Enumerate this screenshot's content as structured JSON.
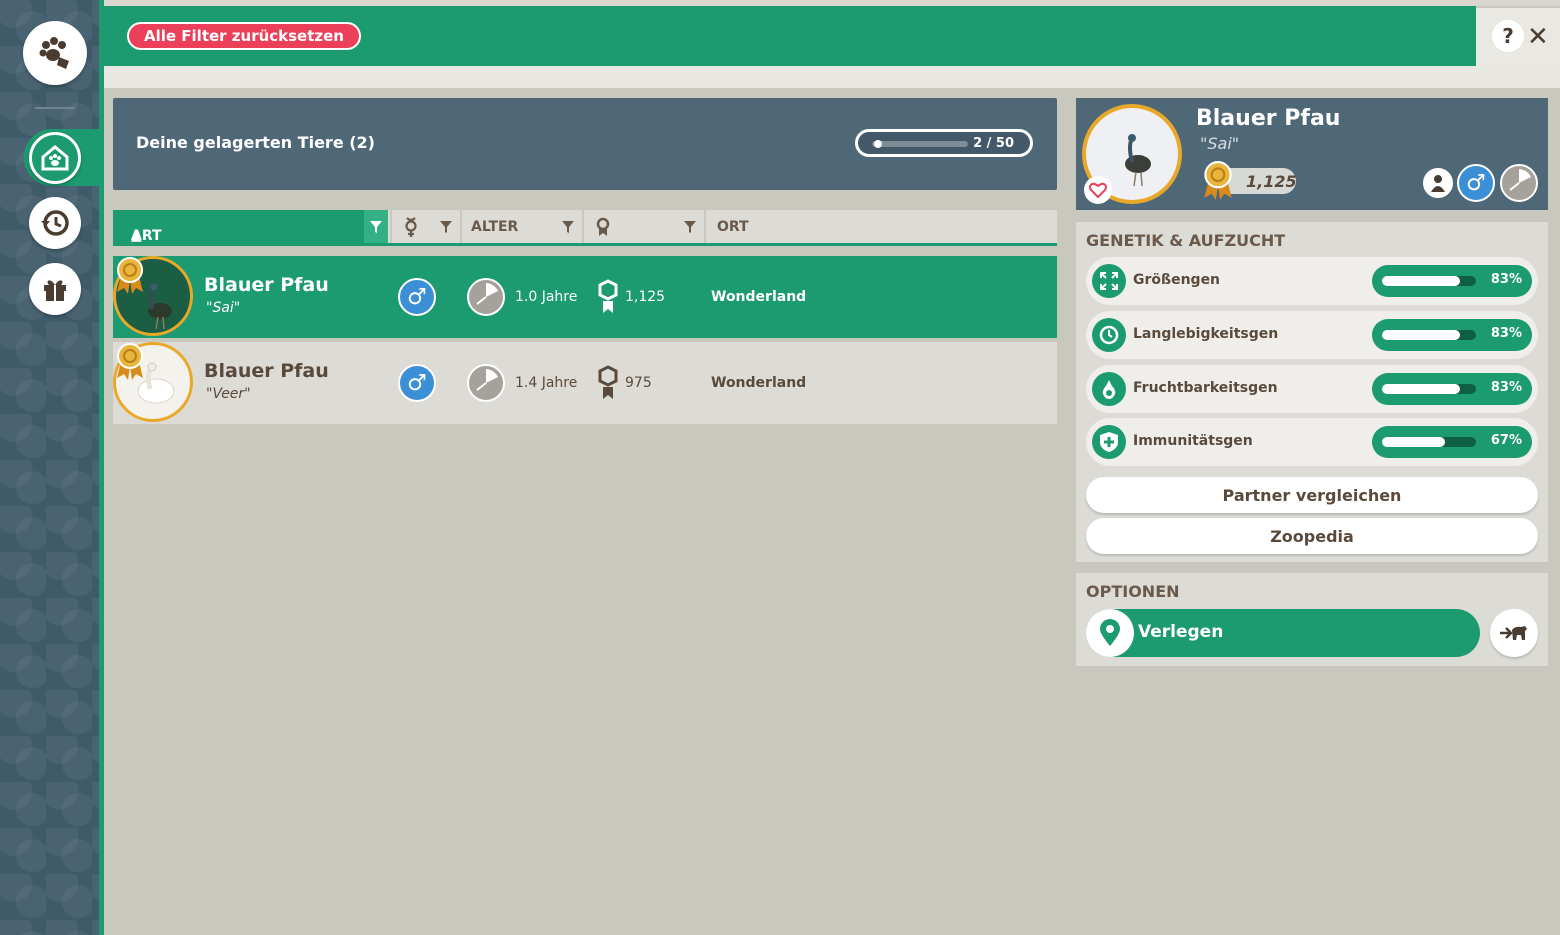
{
  "toolbar": {
    "reset_label": "Alle Filter zurücksetzen",
    "help_label": "?",
    "close_label": "✕"
  },
  "sidebar": {
    "items": [
      {
        "name": "paw-tag-icon"
      },
      {
        "name": "storage-house-icon",
        "active": true
      },
      {
        "name": "history-icon"
      },
      {
        "name": "gift-icon"
      }
    ]
  },
  "storage": {
    "title": "Deine gelagerten Tiere (2)",
    "capacity_label": "2 / 50",
    "capacity_used": 2,
    "capacity_max": 50
  },
  "columns": {
    "art": "ART",
    "alter": "ALTER",
    "ort": "ORT"
  },
  "animals": [
    {
      "name": "Blauer Pfau",
      "nickname": "\"Sai\"",
      "sex": "♂",
      "age": "1.0 Jahre",
      "appeal": "1,125",
      "location": "Wonderland",
      "selected": true
    },
    {
      "name": "Blauer Pfau",
      "nickname": "\"Veer\"",
      "sex": "♂",
      "age": "1.4 Jahre",
      "appeal": "975",
      "location": "Wonderland",
      "selected": false
    }
  ],
  "detail": {
    "name": "Blauer Pfau",
    "nickname": "\"Sai\"",
    "appeal": "1,125",
    "sex": "♂"
  },
  "genetics": {
    "title": "GENETIK & AUFZUCHT",
    "genes": [
      {
        "label": "Größengen",
        "value": "83%",
        "fraction": 0.83,
        "icon": "resize-icon"
      },
      {
        "label": "Langlebigkeitsgen",
        "value": "83%",
        "fraction": 0.83,
        "icon": "clock-icon"
      },
      {
        "label": "Fruchtbarkeitsgen",
        "value": "83%",
        "fraction": 0.83,
        "icon": "fertility-icon"
      },
      {
        "label": "Immunitätsgen",
        "value": "67%",
        "fraction": 0.67,
        "icon": "shield-plus-icon"
      }
    ],
    "compare_label": "Partner vergleichen",
    "zoopedia_label": "Zoopedia"
  },
  "options": {
    "title": "OPTIONEN",
    "move_label": "Verlegen"
  },
  "colors": {
    "accent": "#1c9a70",
    "panel": "#4f6878",
    "reset": "#ec3f5a",
    "male": "#3b8fd6",
    "gold": "#e9a82a"
  }
}
